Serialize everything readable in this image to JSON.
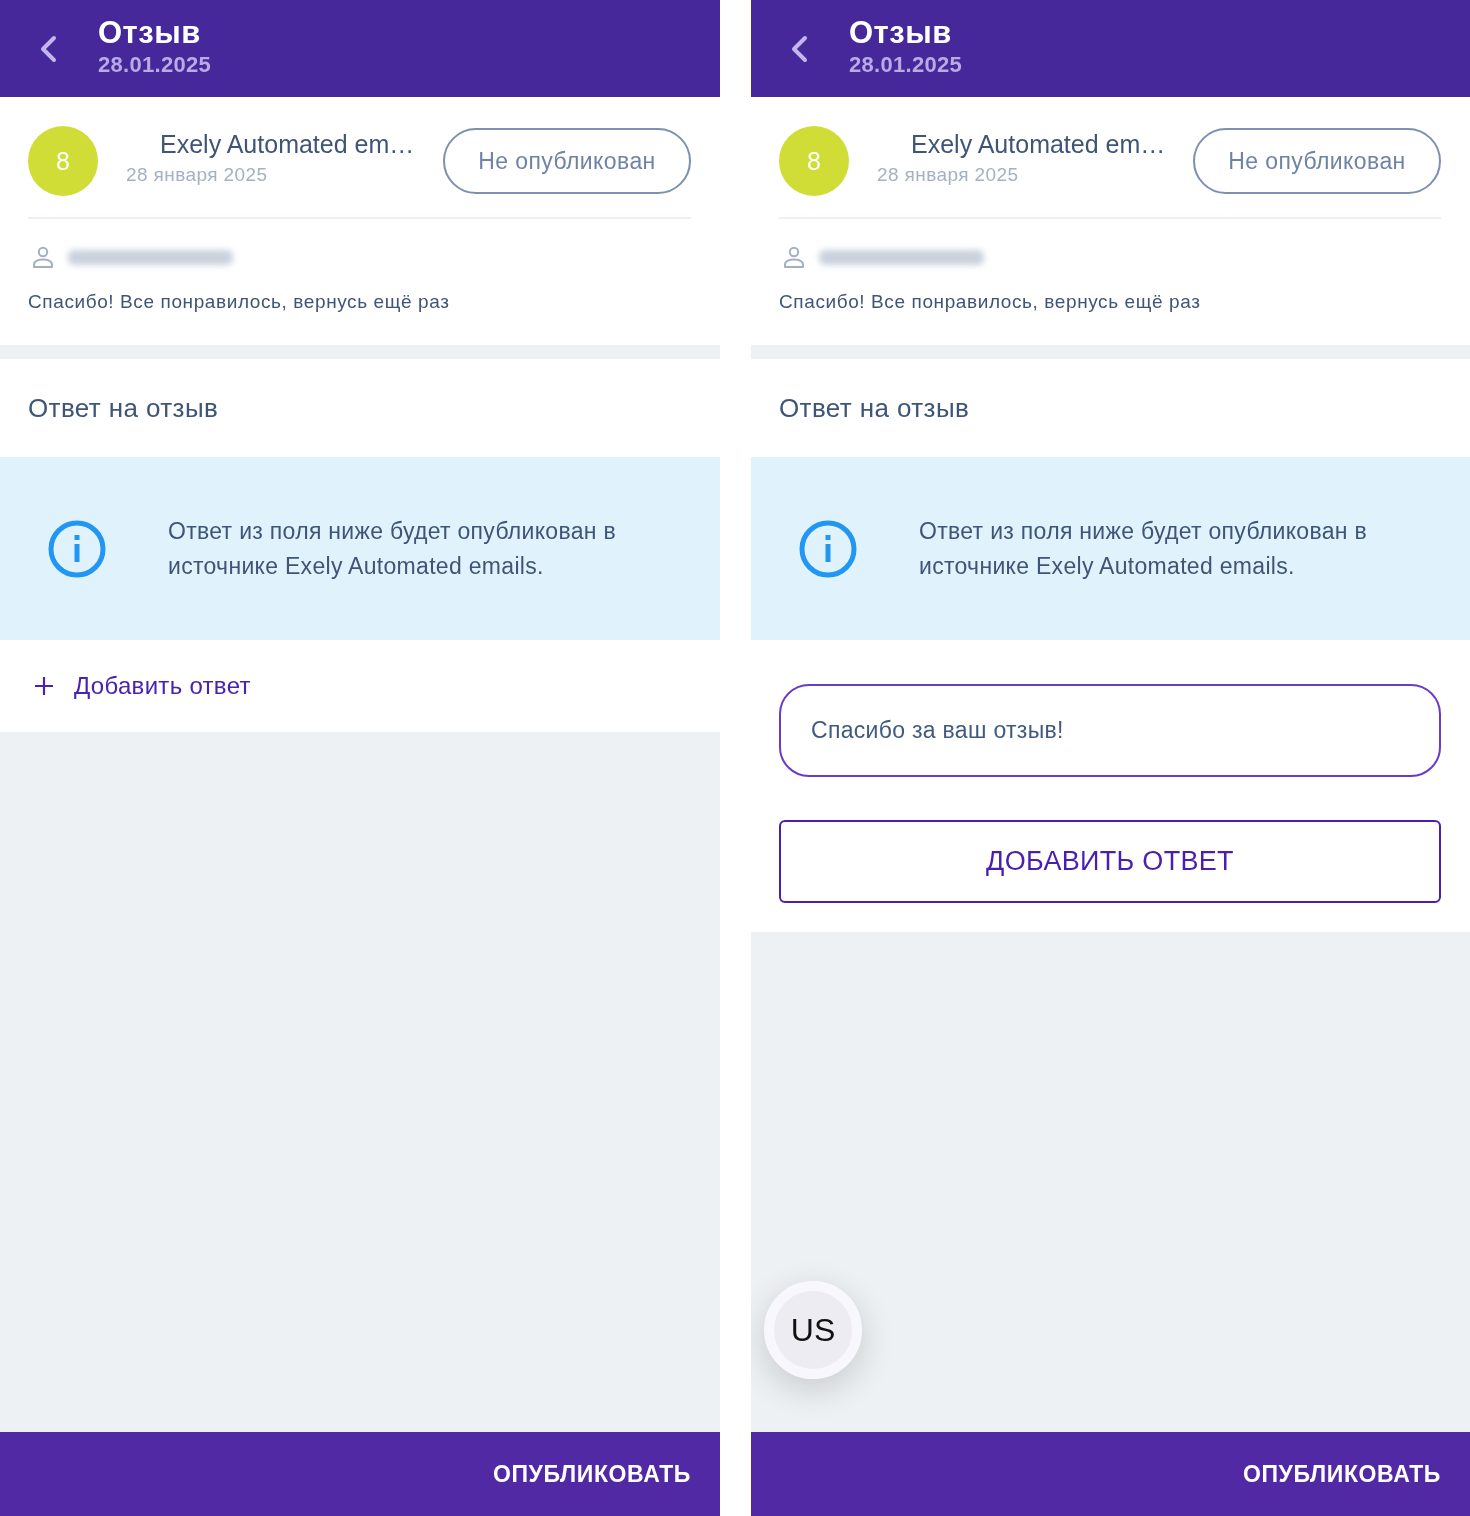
{
  "screens": [
    {
      "header": {
        "title": "Отзыв",
        "subtitle": "28.01.2025"
      },
      "review": {
        "score": "8",
        "source": "Exely Automated em…",
        "date": "28 января 2025",
        "status": "Не опубликован",
        "text": "Спасибо! Все понравилось, вернусь ещё раз"
      },
      "reply_section": {
        "title": "Ответ на отзыв",
        "info": "Ответ из поля ниже будет опубликован в источнике Exely Automated emails."
      },
      "reply": {
        "kind": "link",
        "label": "Добавить ответ"
      },
      "footer": {
        "button": "ОПУБЛИКОВАТЬ"
      }
    },
    {
      "header": {
        "title": "Отзыв",
        "subtitle": "28.01.2025"
      },
      "review": {
        "score": "8",
        "source": "Exely Automated em…",
        "date": "28 января 2025",
        "status": "Не опубликован",
        "text": "Спасибо! Все понравилось, вернусь ещё раз"
      },
      "reply_section": {
        "title": "Ответ на отзыв",
        "info": "Ответ из поля ниже будет опубликован в источнике Exely Automated emails."
      },
      "reply": {
        "kind": "form",
        "value": "Спасибо за ваш отзыв!",
        "button": "ДОБАВИТЬ ОТВЕТ"
      },
      "floating_button": {
        "label": "US"
      },
      "footer": {
        "button": "ОПУБЛИКОВАТЬ"
      }
    }
  ]
}
